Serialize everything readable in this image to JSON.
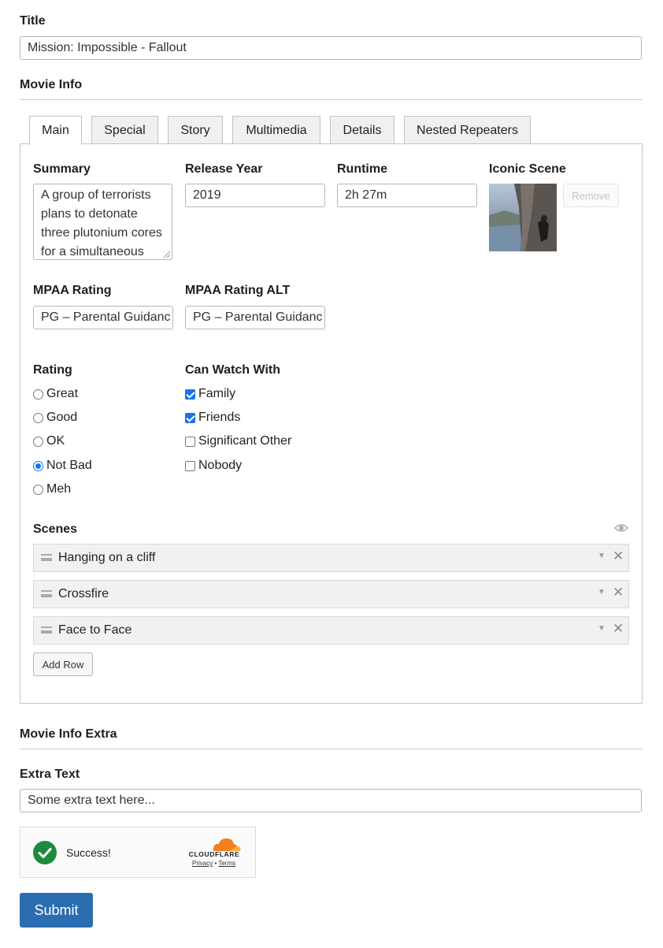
{
  "title_field": {
    "label": "Title",
    "value": "Mission: Impossible - Fallout"
  },
  "movie_info": {
    "heading": "Movie Info",
    "tabs": [
      "Main",
      "Special",
      "Story",
      "Multimedia",
      "Details",
      "Nested Repeaters"
    ],
    "active_tab": "Main",
    "summary": {
      "label": "Summary",
      "lines": [
        "A group of terrorists",
        "plans to detonate",
        "three plutonium cores",
        "for a simultaneous"
      ]
    },
    "release_year": {
      "label": "Release Year",
      "value": "2019"
    },
    "runtime": {
      "label": "Runtime",
      "value": "2h 27m"
    },
    "iconic_scene": {
      "label": "Iconic Scene",
      "remove_label": "Remove"
    },
    "mpaa_rating": {
      "label": "MPAA Rating",
      "value": "PG – Parental Guidanc"
    },
    "mpaa_rating_alt": {
      "label": "MPAA Rating ALT",
      "value": "PG – Parental Guidanc"
    },
    "rating": {
      "label": "Rating",
      "options": [
        "Great",
        "Good",
        "OK",
        "Not Bad",
        "Meh"
      ],
      "selected": "Not Bad"
    },
    "can_watch_with": {
      "label": "Can Watch With",
      "options": [
        {
          "label": "Family",
          "checked": true
        },
        {
          "label": "Friends",
          "checked": true
        },
        {
          "label": "Significant Other",
          "checked": false
        },
        {
          "label": "Nobody",
          "checked": false
        }
      ]
    },
    "scenes": {
      "label": "Scenes",
      "rows": [
        "Hanging on a cliff",
        "Crossfire",
        "Face to Face"
      ],
      "add_row_label": "Add Row"
    }
  },
  "movie_info_extra": {
    "heading": "Movie Info Extra",
    "extra_text": {
      "label": "Extra Text",
      "value": "Some extra text here..."
    }
  },
  "captcha": {
    "status": "Success!",
    "brand": "CLOUDFLARE",
    "privacy_label": "Privacy",
    "separator": "•",
    "terms_label": "Terms"
  },
  "submit_label": "Submit",
  "colors": {
    "accent": "#2a6db0",
    "check_blue": "#1a73e8",
    "success_green": "#1e8a3e",
    "cloudflare_orange": "#f38020"
  }
}
